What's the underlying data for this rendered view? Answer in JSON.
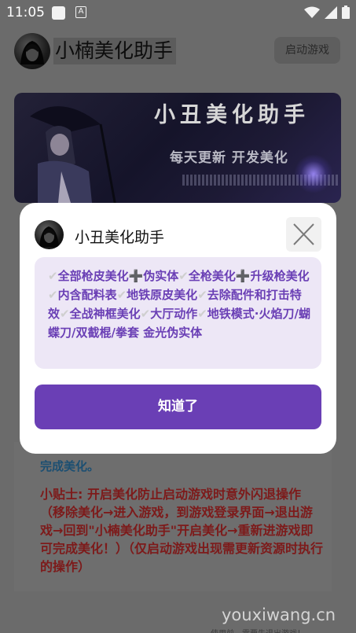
{
  "status_bar": {
    "time": "11:05",
    "app_icon_letter": "A",
    "icons": [
      "wifi-icon",
      "signal-icon",
      "battery-icon"
    ]
  },
  "app": {
    "title": "小楠美化助手",
    "start_button": "启动游戏"
  },
  "banner": {
    "title": "小丑美化助手",
    "subtitle": "每天更新 开发美化"
  },
  "background_card": {
    "completed_text": "完成美化。",
    "tip": "小贴士: 开启美化防止启动游戏时意外闪退操作（移除美化→进入游戏，到游戏登录界面→退出游戏→回到\"小楠美化助手\"开启美化→重新进游戏即可完成美化！）（仅启动游戏出现需更新资源时执行的操作）"
  },
  "dialog": {
    "title": "小丑美化助手",
    "features": [
      {
        "check": "✔",
        "text": "全部枪皮美化",
        "plus": "➕",
        "text2": "伪实体"
      },
      {
        "check": "✔",
        "text": "全枪美化",
        "plus": "➕",
        "text2": "升级枪美化"
      },
      {
        "check": "✔",
        "text": "内含配料表"
      },
      {
        "check": "✔",
        "text": "地铁原皮美化"
      },
      {
        "check": "✔",
        "text": "去除配件和打击特效"
      },
      {
        "check": "✔",
        "text": "全战神框美化"
      },
      {
        "check": "✔",
        "text": "大厅动作"
      },
      {
        "check": "✔",
        "text": "地铁模式·火焰刀/蝴蝶刀/双截棍/拳套 金光伪实体"
      }
    ],
    "ok_button": "知道了"
  },
  "watermark": "youxiwang.cn",
  "bottom_hint": "使用前，需要先退出游戏！",
  "colors": {
    "accent": "#6a3fb5",
    "content_bg": "#ede7f6",
    "tip_red": "#7d1a1a",
    "done_blue": "#1c4f72"
  }
}
